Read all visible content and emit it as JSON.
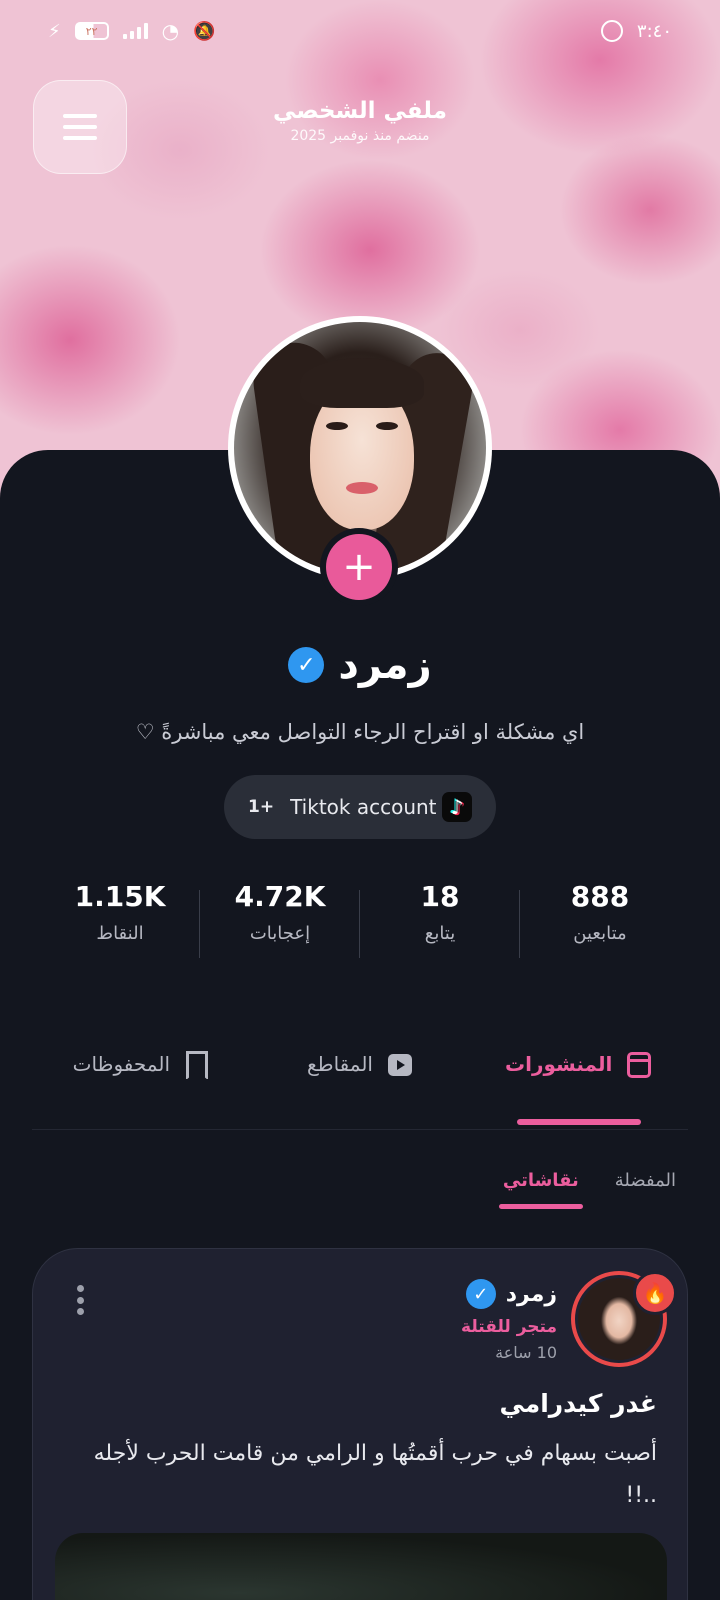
{
  "status_bar": {
    "time": "٣:٤٠",
    "battery": "٢٢"
  },
  "header": {
    "title": "ملفي الشخصي",
    "joined": "منضم منذ نوفمبر 2025"
  },
  "profile": {
    "name": "زمرد",
    "bio": "اي مشكلة او اقتراح الرجاء التواصل معي مباشرةً ♡",
    "link_label": "Tiktok account",
    "link_count": "1+"
  },
  "stats": [
    {
      "value": "888",
      "label": "متابعين"
    },
    {
      "value": "18",
      "label": "يتابع"
    },
    {
      "value": "4.72K",
      "label": "إعجابات"
    },
    {
      "value": "1.15K",
      "label": "النقاط"
    }
  ],
  "tabs": [
    {
      "label": "المنشورات",
      "active": true
    },
    {
      "label": "المقاطع",
      "active": false
    },
    {
      "label": "المحفوظات",
      "active": false
    }
  ],
  "subtabs": [
    {
      "label": "نقاشاتي",
      "active": true
    },
    {
      "label": "المفضلة",
      "active": false
    }
  ],
  "post": {
    "author": "زمرد",
    "shop": "متجر للقتلة",
    "time": "10 ساعة",
    "title": "غدر كيدرامي",
    "body": "أصبت بسهام في حرب أقمتُها و الرامي من قامت الحرب لأجله ..!!"
  },
  "colors": {
    "accent": "#ec5e9e",
    "background": "#13161f",
    "verified": "#2f97f0",
    "fire": "#e94a4a"
  },
  "icons": {
    "menu": "hamburger-icon",
    "plus": "plus-icon",
    "verified": "verified-check-icon",
    "tiktok": "tiktok-icon",
    "posts_tab": "document-icon",
    "clips_tab": "play-icon",
    "saved_tab": "bookmark-icon",
    "more": "more-vertical-icon",
    "fire": "fire-icon"
  }
}
